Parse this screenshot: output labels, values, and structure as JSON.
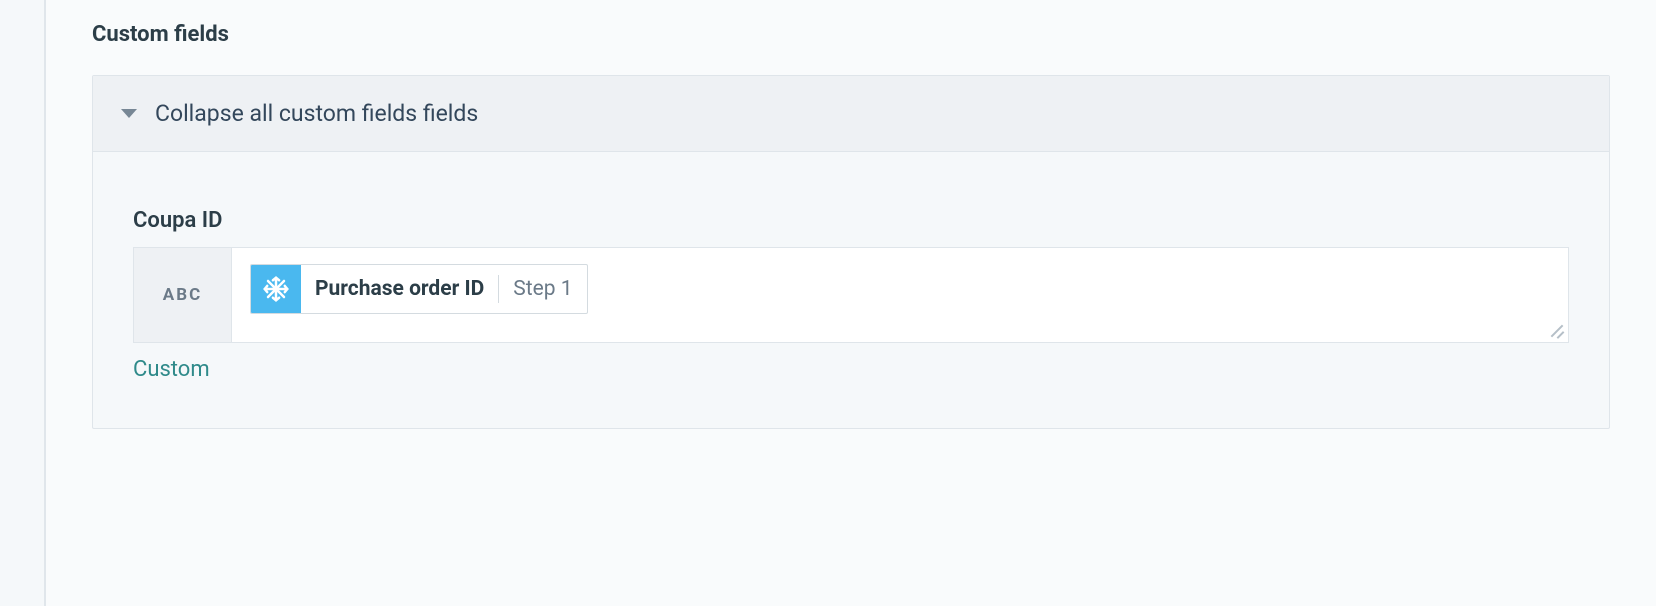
{
  "section": {
    "title": "Custom fields",
    "panel": {
      "collapse_label": "Collapse all custom fields fields",
      "field": {
        "label": "Coupa ID",
        "type_indicator": "ABC",
        "pill": {
          "icon_name": "snowflake-icon",
          "label": "Purchase order ID",
          "step": "Step 1"
        },
        "custom_link": "Custom"
      }
    }
  }
}
